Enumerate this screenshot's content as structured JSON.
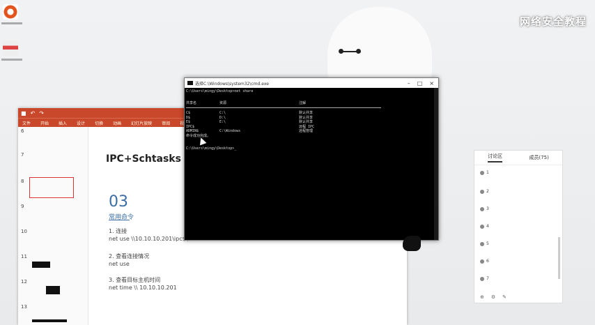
{
  "watermark": "网络安全教程",
  "ppt": {
    "title_hint": "",
    "ribbon_tabs": [
      "文件",
      "开始",
      "插入",
      "设计",
      "切换",
      "动画",
      "幻灯片放映",
      "审阅",
      "视图",
      "帮助"
    ],
    "slide_numbers": [
      "6",
      "7",
      "8",
      "9",
      "10",
      "11",
      "12",
      "13"
    ],
    "slide": {
      "title": "IPC+Schtasks",
      "number": "03",
      "subtitle": "常用命令",
      "items": [
        "1. 连接",
        "net use \\\\10.10.10.201\\ipc$ /u",
        "2. 查看连接情况",
        "net use",
        "3. 查看目标主机时间",
        "net time \\\\ 10.10.10.201"
      ]
    }
  },
  "cmd": {
    "title": "选择C:\\Windows\\system32\\cmd.exe",
    "prompt1": "C:\\Users\\mingy\\Desktop>net share",
    "headers": [
      "共享名",
      "资源",
      "注解"
    ],
    "rows": [
      [
        "C$",
        "C:\\",
        "默认共享"
      ],
      [
        "D$",
        "D:\\",
        "默认共享"
      ],
      [
        "E$",
        "E:\\",
        "默认共享"
      ],
      [
        "IPC$",
        "",
        "远程 IPC"
      ],
      [
        "ADMIN$",
        "C:\\Windows",
        "远程管理"
      ]
    ],
    "done": "命令成功完成。",
    "prompt2": "C:\\Users\\mingy\\Desktop>"
  },
  "side_panel": {
    "tabs": [
      "讨论区",
      "成员(75)"
    ],
    "items": [
      "1",
      "2",
      "3",
      "4",
      "5",
      "6",
      "7"
    ],
    "footer": [
      "⊕",
      "⚙",
      "✎"
    ]
  }
}
